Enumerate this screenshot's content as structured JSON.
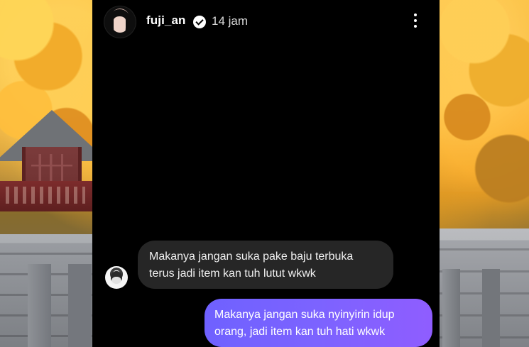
{
  "story_viewer": {
    "header": {
      "username": "fuji_an",
      "timestamp": "14 jam",
      "menu_icon": "more-vertical-icon",
      "verified_icon": "verified-badge-icon"
    },
    "messages": [
      {
        "sender": "other",
        "lines": [
          "Makanya jangan suka pake baju terbuka",
          "terus jadi item kan tuh lutut wkwk"
        ]
      },
      {
        "sender": "me",
        "lines": [
          "Makanya jangan suka nyinyirin idup",
          "orang, jadi item kan tuh hati wkwk"
        ]
      }
    ],
    "colors": {
      "sent_bubble": "#7C63FF",
      "received_bubble": "#262626",
      "viewer_background": "#000000"
    }
  }
}
